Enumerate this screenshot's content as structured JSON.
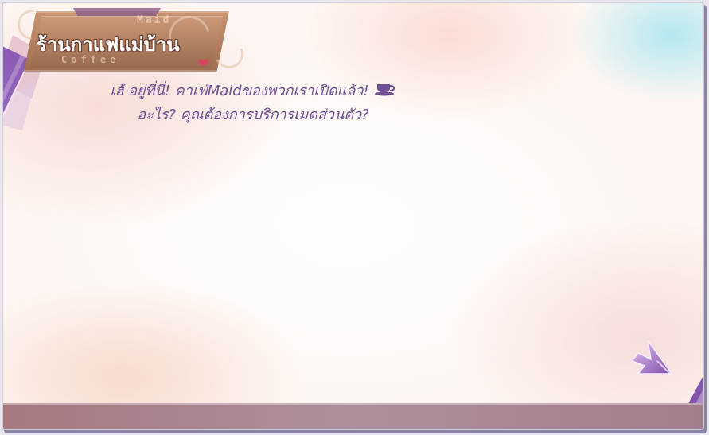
{
  "title": {
    "text": "ร้านกาแฟแม่บ้าน",
    "watermark_top": "Maid",
    "watermark_bottom": "Coffee"
  },
  "dialogue": {
    "line1": "เฮ้ อยู่ที่นี่! คาเฟ่Maidของพวกเราเปิดแล้ว!",
    "line2": "อะไร? คุณต้องการบริการเมดส่วนตัว?"
  },
  "icons": {
    "cup": "coffee-cup-icon",
    "heart": "heart-icon",
    "next": "next-arrow-icon"
  },
  "colors": {
    "text": "#6f4e95",
    "ribbon": "#8d5ab8",
    "plate": "#b07d5d",
    "heart": "#d8455c",
    "bar": "#a5797f"
  }
}
